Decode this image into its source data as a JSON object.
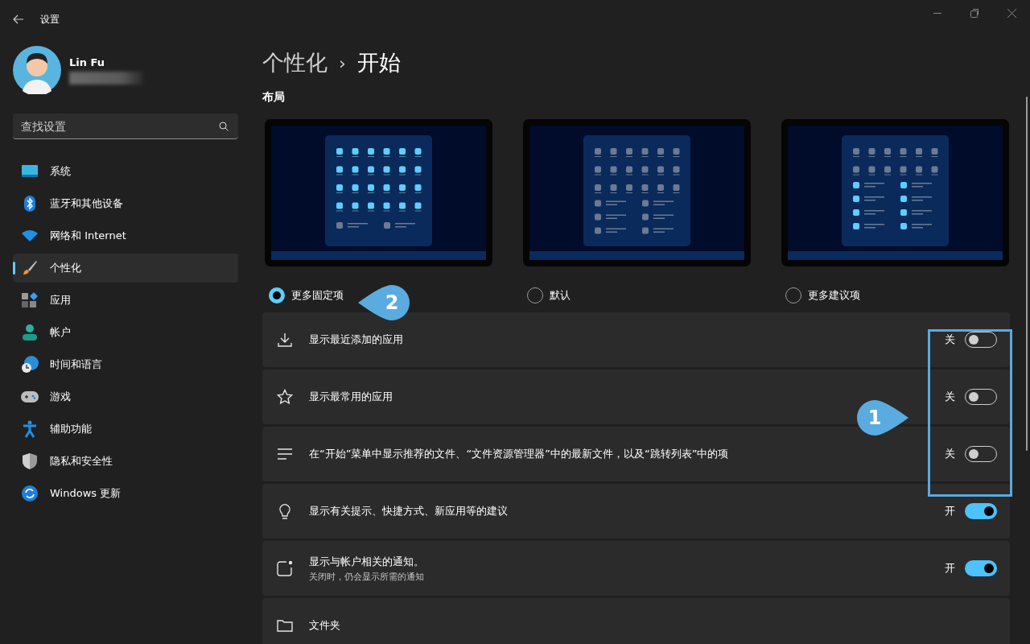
{
  "window": {
    "title": "设置"
  },
  "profile": {
    "name": "Lin Fu"
  },
  "search": {
    "placeholder": "查找设置"
  },
  "sidebar": {
    "items": [
      {
        "label": "系统",
        "selected": false
      },
      {
        "label": "蓝牙和其他设备",
        "selected": false
      },
      {
        "label": "网络和 Internet",
        "selected": false
      },
      {
        "label": "个性化",
        "selected": true
      },
      {
        "label": "应用",
        "selected": false
      },
      {
        "label": "帐户",
        "selected": false
      },
      {
        "label": "时间和语言",
        "selected": false
      },
      {
        "label": "游戏",
        "selected": false
      },
      {
        "label": "辅助功能",
        "selected": false
      },
      {
        "label": "隐私和安全性",
        "selected": false
      },
      {
        "label": "Windows 更新",
        "selected": false
      }
    ]
  },
  "breadcrumb": {
    "items": [
      "个性化",
      "开始"
    ],
    "separator": "›"
  },
  "layout_section": {
    "title": "布局",
    "options": [
      {
        "label": "更多固定项",
        "selected": true,
        "kind": "pins"
      },
      {
        "label": "默认",
        "selected": false,
        "kind": "default"
      },
      {
        "label": "更多建议项",
        "selected": false,
        "kind": "recommendations"
      }
    ]
  },
  "settings": [
    {
      "title": "显示最近添加的应用",
      "toggle": {
        "state_label": "关",
        "on": false
      }
    },
    {
      "title": "显示最常用的应用",
      "toggle": {
        "state_label": "关",
        "on": false
      }
    },
    {
      "title": "在“开始”菜单中显示推荐的文件、“文件资源管理器”中的最新文件，以及“跳转列表”中的项",
      "toggle": {
        "state_label": "关",
        "on": false
      }
    },
    {
      "title": "显示有关提示、快捷方式、新应用等的建议",
      "toggle": {
        "state_label": "开",
        "on": true
      }
    },
    {
      "title": "显示与帐户相关的通知。",
      "subtitle": "关闭时，仍会显示所需的通知",
      "toggle": {
        "state_label": "开",
        "on": true
      }
    },
    {
      "title": "文件夹"
    }
  ],
  "annotations": [
    {
      "label": "2",
      "kind": "left"
    },
    {
      "label": "1",
      "kind": "right"
    }
  ]
}
